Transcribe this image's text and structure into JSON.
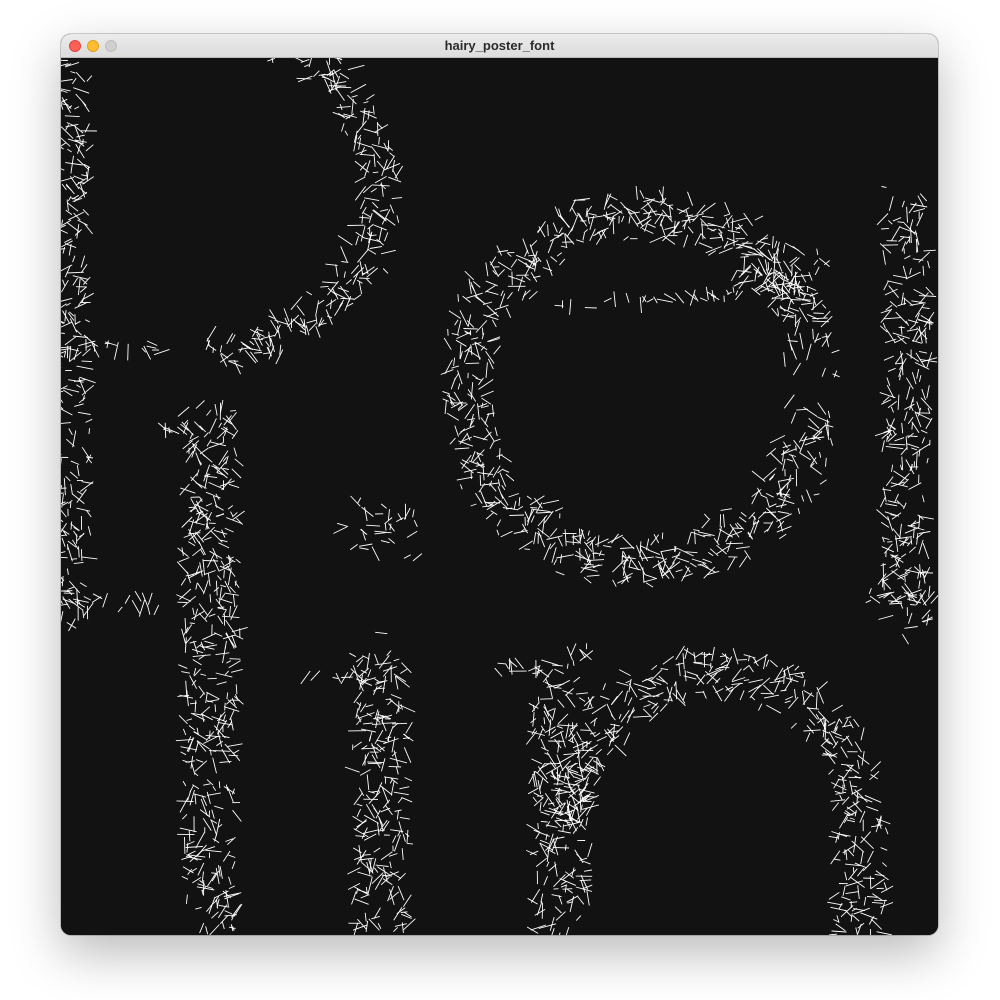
{
  "window": {
    "title": "hairy_poster_font"
  },
  "colors": {
    "canvas_background": "#121212",
    "hair_color": "#ffffff",
    "close_button": "#fe5f57",
    "minimize_button": "#febc2e",
    "zoom_button": "#cfcfcf"
  },
  "icons": {
    "close": "close-icon",
    "minimize": "minimize-icon",
    "zoom": "zoom-icon"
  }
}
